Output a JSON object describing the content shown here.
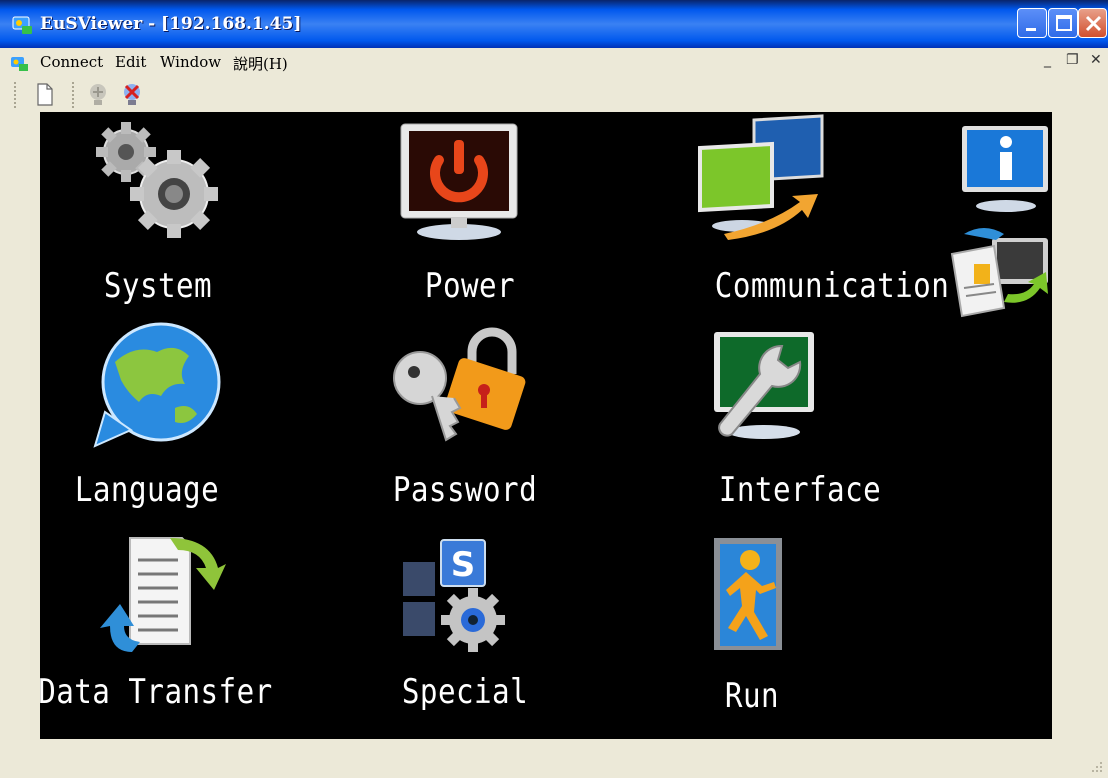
{
  "window": {
    "title": "EuSViewer - [192.168.1.45]",
    "buttons": [
      "minimize-icon",
      "maximize-icon",
      "close-icon"
    ]
  },
  "menubar": {
    "items": [
      "Connect",
      "Edit",
      "Window",
      "說明(H)"
    ],
    "mdi_controls": [
      "_",
      "❐",
      "✕"
    ]
  },
  "toolbar": {
    "buttons": [
      "new-document-icon",
      "connect-icon",
      "disconnect-icon"
    ]
  },
  "screen": {
    "tiles": [
      {
        "label": "System",
        "icon": "gears-icon"
      },
      {
        "label": "Power",
        "icon": "power-monitor-icon"
      },
      {
        "label": "Communication",
        "icon": "communication-monitors-icon"
      },
      {
        "label": "Language",
        "icon": "globe-icon"
      },
      {
        "label": "Password",
        "icon": "key-lock-icon"
      },
      {
        "label": "Interface",
        "icon": "wrench-monitor-icon"
      },
      {
        "label": "Data Transfer",
        "icon": "document-transfer-icon"
      },
      {
        "label": "Special",
        "icon": "special-settings-icon"
      },
      {
        "label": "Run",
        "icon": "running-man-door-icon"
      }
    ],
    "side_icons": [
      "info-monitor-icon",
      "contact-sync-icon"
    ]
  },
  "colors": {
    "titlebar": "#0058EE",
    "face": "#ECE9D8",
    "screen": "#000000",
    "label": "#FFFFFF"
  }
}
